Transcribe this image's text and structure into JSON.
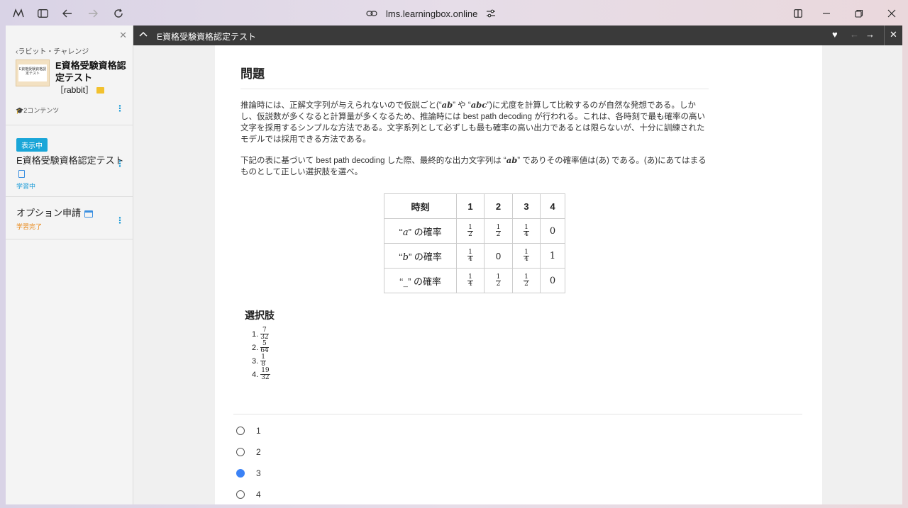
{
  "browser": {
    "url": "lms.learningbox.online"
  },
  "sidebar": {
    "breadcrumb": "ラビット・チャレンジ",
    "course_title": "E資格受験資格認定テスト",
    "course_tag": "［rabbit］",
    "thumb_text": "E資格受験資格認定テスト",
    "content_count": "2コンテンツ",
    "items": [
      {
        "badge": "表示中",
        "title": "E資格受験資格認定テスト",
        "status": "学習中"
      },
      {
        "title": "オプション申請",
        "status": "学習完了"
      }
    ]
  },
  "topbar": {
    "title": "E資格受験資格認定テスト"
  },
  "question": {
    "heading": "問題",
    "para1_a": "推論時には、正解文字列が与えられないので仮説ごと(“",
    "para1_ab": "ab",
    "para1_b": "” や “",
    "para1_abc": "abc",
    "para1_c": "”)に尤度を計算して比較するのが自然な発想である。しかし、仮説数が多くなると計算量が多くなるため、推論時には best path decoding が行われる。これは、各時刻で最も確率の高い文字を採用するシンプルな方法である。文字系列として必ずしも最も確率の高い出力であるとは限らないが、十分に訓練されたモデルでは採用できる方法である。",
    "para2_a": "下記の表に基づいて best path decoding した際、最終的な出力文字列は “",
    "para2_ab": "ab",
    "para2_b": "” でありその確率値は(あ) である。(あ)にあてはまるものとして正しい選択肢を選べ。",
    "table": {
      "header": [
        "時刻",
        "1",
        "2",
        "3",
        "4"
      ],
      "rows": [
        {
          "label_open": "‘‘",
          "label_var": "a",
          "label_close": "” の確率",
          "cells": [
            [
              "1",
              "2"
            ],
            [
              "1",
              "2"
            ],
            [
              "1",
              "4"
            ],
            "0"
          ]
        },
        {
          "label_open": "‘‘",
          "label_var": "b",
          "label_close": "” の確率",
          "cells": [
            [
              "1",
              "4"
            ],
            "0",
            [
              "1",
              "4"
            ],
            "1"
          ]
        },
        {
          "label_open": "‘‘",
          "label_var": "_",
          "label_close": "” の確率",
          "cells": [
            [
              "1",
              "4"
            ],
            [
              "1",
              "2"
            ],
            [
              "1",
              "2"
            ],
            "0"
          ]
        }
      ]
    },
    "choices_heading": "選択肢",
    "choices": [
      {
        "n": "1.",
        "num": "7",
        "den": "32"
      },
      {
        "n": "2.",
        "num": "5",
        "den": "64"
      },
      {
        "n": "3.",
        "num": "1",
        "den": "8"
      },
      {
        "n": "4.",
        "num": "19",
        "den": "32"
      }
    ]
  },
  "answers": {
    "options": [
      "1",
      "2",
      "3",
      "4"
    ],
    "selected": "3"
  }
}
